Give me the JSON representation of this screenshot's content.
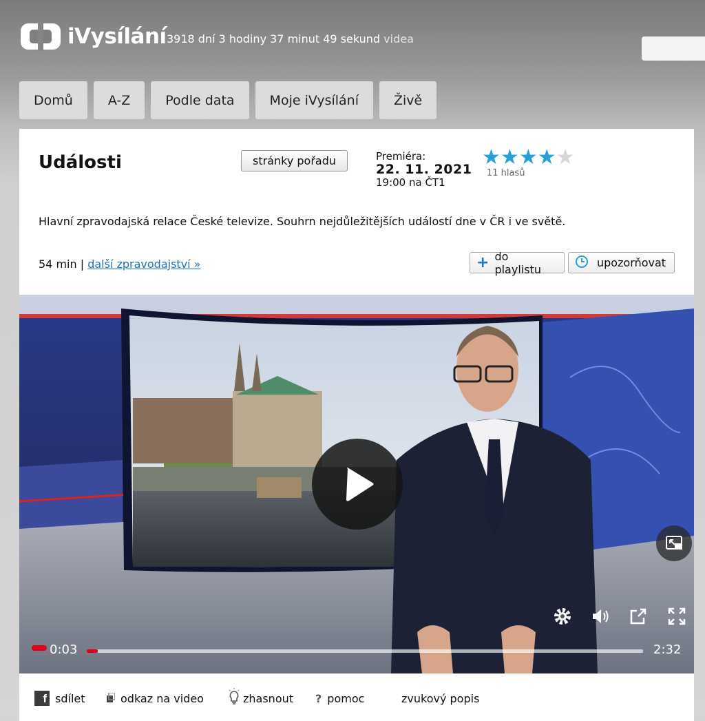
{
  "header": {
    "logo_text": "iVysílání",
    "counter_text": "3918 dní 3 hodiny 37 minut 49 sekund",
    "counter_suffix": "videa"
  },
  "nav": {
    "items": [
      "Domů",
      "A-Z",
      "Podle data",
      "Moje iVysílání",
      "Živě"
    ]
  },
  "program": {
    "title": "Události",
    "program_page_button": "stránky pořadu",
    "premiere_label": "Premiéra:",
    "premiere_date": "22. 11. 2021",
    "premiere_time": "19:00 na ČT1",
    "rating": 4,
    "rating_max": 5,
    "votes_text": "11 hlasů",
    "description": "Hlavní zpravodajská relace České televize. Souhrn nejdůležitějších událostí dne v ČR i ve světě.",
    "duration": "54 min",
    "separator": "|",
    "more_link": "další zpravodajství »",
    "playlist_button": "do playlistu",
    "notify_button": "upozorňovat"
  },
  "player": {
    "current_time": "0:03",
    "total_time": "2:32",
    "progress": 0.02,
    "icons": [
      "play-icon",
      "pip-icon",
      "settings-icon",
      "volume-icon",
      "share-icon",
      "fullscreen-icon"
    ]
  },
  "bottom_bar": {
    "share": "sdílet",
    "video_link": "odkaz na video",
    "dim": "zhasnout",
    "help_mark": "?",
    "help": "pomoc",
    "audio_description": "zvukový popis"
  },
  "colors": {
    "accent_blue": "#27a0d6",
    "progress_red": "#e0001a"
  }
}
